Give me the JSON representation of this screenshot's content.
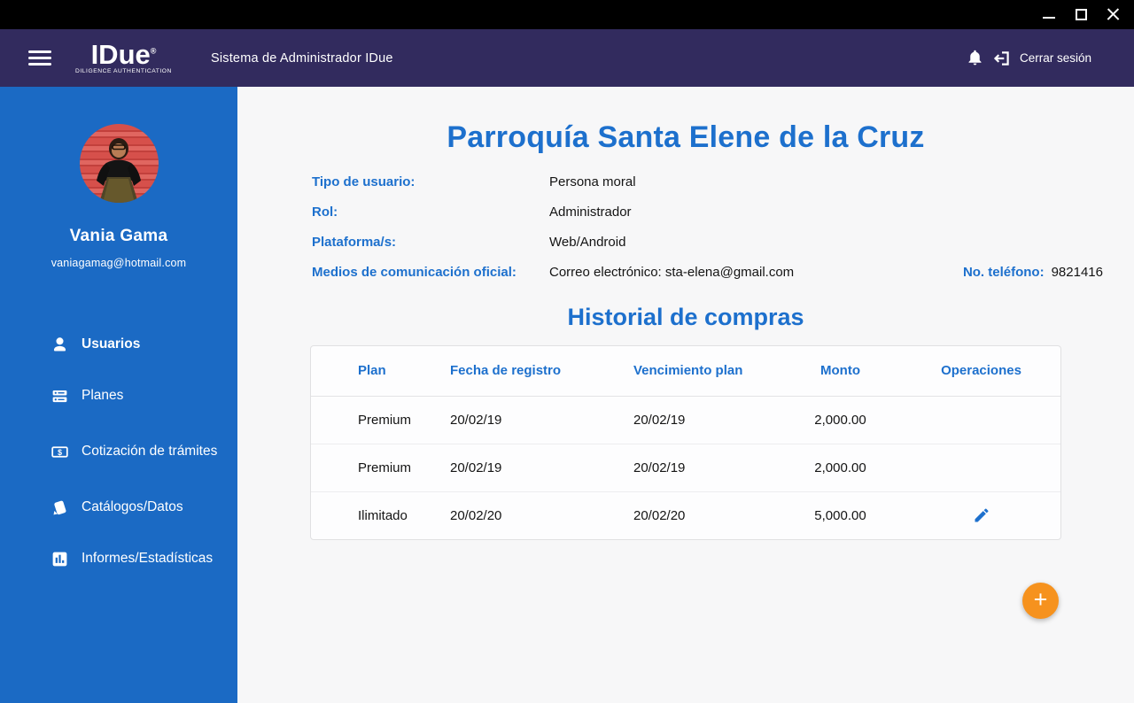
{
  "window": {
    "controls": {
      "minimize": "minimize",
      "maximize": "maximize",
      "close": "close"
    }
  },
  "header": {
    "logo": {
      "text": "IDue",
      "registered": "®",
      "subtitle": "DILIGENCE AUTHENTICATION"
    },
    "app_title": "Sistema de Administrador IDue",
    "logout_label": "Cerrar sesión",
    "icons": {
      "menu": "hamburger-icon",
      "notifications": "bell-icon",
      "logout": "logout-icon"
    }
  },
  "sidebar": {
    "user": {
      "name": "Vania Gama",
      "email": "vaniagamag@hotmail.com"
    },
    "items": [
      {
        "label": "Usuarios",
        "icon": "user-icon",
        "active": true
      },
      {
        "label": "Planes",
        "icon": "plans-icon",
        "active": false
      },
      {
        "label": "Cotización de trámites",
        "icon": "quote-icon",
        "active": false
      },
      {
        "label": "Catálogos/Datos",
        "icon": "catalog-icon",
        "active": false
      },
      {
        "label": "Informes/Estadísticas",
        "icon": "stats-icon",
        "active": false
      }
    ]
  },
  "main": {
    "title": "Parroquía Santa Elene de la Cruz",
    "details": [
      {
        "label": "Tipo de usuario:",
        "value": "Persona moral"
      },
      {
        "label": "Rol:",
        "value": "Administrador"
      },
      {
        "label": "Plataforma/s:",
        "value": "Web/Android"
      },
      {
        "label": "Medios de comunicación oficial:",
        "value": "Correo electrónico: sta-elena@gmail.com",
        "phone_label": "No. teléfono:",
        "phone_value": "9821416"
      }
    ],
    "purchases": {
      "title": "Historial de compras",
      "columns": [
        "Plan",
        "Fecha de registro",
        "Vencimiento plan",
        "Monto",
        "Operaciones"
      ],
      "rows": [
        {
          "plan": "Premium",
          "registered": "20/02/19",
          "expires": "20/02/19",
          "amount": "2,000.00",
          "editable": false
        },
        {
          "plan": "Premium",
          "registered": "20/02/19",
          "expires": "20/02/19",
          "amount": "2,000.00",
          "editable": false
        },
        {
          "plan": "Ilimitado",
          "registered": "20/02/20",
          "expires": "20/02/20",
          "amount": "5,000.00",
          "editable": true
        }
      ],
      "edit_icon": "pencil-icon"
    },
    "fab": {
      "label": "+",
      "icon": "plus-icon"
    }
  },
  "colors": {
    "titlebar": "#000000",
    "header": "#322b5e",
    "sidebar": "#1b6ac4",
    "accent_blue": "#1d70cd",
    "fab_orange": "#f6921e",
    "content_bg": "#f7f7f8"
  }
}
